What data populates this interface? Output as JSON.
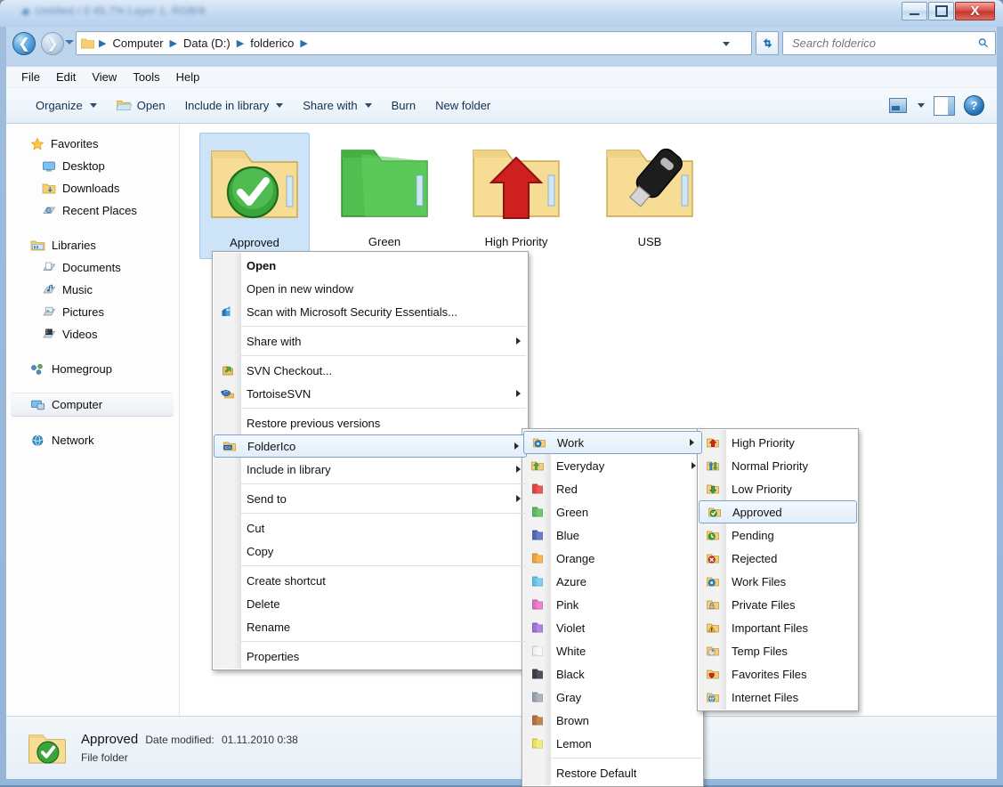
{
  "window": {
    "title_blurred": "Untitled / 0 45.7% Layer 1, RGB/8",
    "buttons": {
      "minimize": "Minimize",
      "maximize": "Maximize",
      "close": "X"
    }
  },
  "address_bar": {
    "back": "Back",
    "forward": "Forward",
    "recent_pages": "Recent Pages",
    "crumbs": [
      "Computer",
      "Data (D:)",
      "folderico"
    ],
    "refresh": "Refresh",
    "dropdown": "Previous Locations"
  },
  "search": {
    "placeholder": "Search folderico",
    "value": "",
    "icon": "search-icon"
  },
  "menubar": {
    "items": [
      "File",
      "Edit",
      "View",
      "Tools",
      "Help"
    ]
  },
  "commandbar": {
    "organize": "Organize",
    "open": "Open",
    "include_in_library": "Include in library",
    "share_with": "Share with",
    "burn": "Burn",
    "new_folder": "New folder",
    "change_view": "Change your view",
    "preview_pane": "Show the preview pane",
    "help": "?"
  },
  "navigation_pane": {
    "groups": [
      {
        "header": "Favorites",
        "icon": "star-icon",
        "items": [
          {
            "label": "Desktop",
            "icon": "desktop-icon"
          },
          {
            "label": "Downloads",
            "icon": "downloads-folder-icon"
          },
          {
            "label": "Recent Places",
            "icon": "recent-places-icon"
          }
        ]
      },
      {
        "header": "Libraries",
        "icon": "libraries-icon",
        "items": [
          {
            "label": "Documents",
            "icon": "documents-library-icon"
          },
          {
            "label": "Music",
            "icon": "music-library-icon"
          },
          {
            "label": "Pictures",
            "icon": "pictures-library-icon"
          },
          {
            "label": "Videos",
            "icon": "videos-library-icon"
          }
        ]
      },
      {
        "header": "Homegroup",
        "icon": "homegroup-icon",
        "items": []
      },
      {
        "header": "Computer",
        "icon": "computer-icon",
        "items": [],
        "selected": true
      },
      {
        "header": "Network",
        "icon": "network-icon",
        "items": []
      }
    ]
  },
  "files": [
    {
      "name": "Approved",
      "icon": "folder-approved-icon",
      "selected": true
    },
    {
      "name": "Green",
      "icon": "folder-green-icon",
      "selected": false
    },
    {
      "name": "High Priority",
      "icon": "folder-high-priority-icon",
      "selected": false
    },
    {
      "name": "USB",
      "icon": "folder-usb-icon",
      "selected": false
    }
  ],
  "details_pane": {
    "name": "Approved",
    "date_modified_label": "Date modified:",
    "date_modified_value": "01.11.2010 0:38",
    "type": "File folder",
    "icon": "folder-approved-icon"
  },
  "context_menu": {
    "items": [
      {
        "label": "Open",
        "bold": true,
        "icon": null,
        "submenu": false
      },
      {
        "label": "Open in new window",
        "icon": null,
        "submenu": false
      },
      {
        "label": "Scan with Microsoft Security Essentials...",
        "icon": "security-essentials-icon",
        "submenu": false
      },
      {
        "separator": true
      },
      {
        "label": "Share with",
        "icon": null,
        "submenu": true
      },
      {
        "separator": true
      },
      {
        "label": "SVN Checkout...",
        "icon": "svn-checkout-icon",
        "submenu": false
      },
      {
        "label": "TortoiseSVN",
        "icon": "tortoisesvn-icon",
        "submenu": true
      },
      {
        "separator": true
      },
      {
        "label": "Restore previous versions",
        "icon": null,
        "submenu": false
      },
      {
        "label": "FolderIco",
        "icon": "folderico-icon",
        "submenu": true,
        "highlighted": true
      },
      {
        "label": "Include in library",
        "icon": null,
        "submenu": true
      },
      {
        "separator": true
      },
      {
        "label": "Send to",
        "icon": null,
        "submenu": true
      },
      {
        "separator": true
      },
      {
        "label": "Cut",
        "icon": null,
        "submenu": false
      },
      {
        "label": "Copy",
        "icon": null,
        "submenu": false
      },
      {
        "separator": true
      },
      {
        "label": "Create shortcut",
        "icon": null,
        "submenu": false
      },
      {
        "label": "Delete",
        "icon": null,
        "submenu": false
      },
      {
        "label": "Rename",
        "icon": null,
        "submenu": false
      },
      {
        "separator": true
      },
      {
        "label": "Properties",
        "icon": null,
        "submenu": false
      }
    ]
  },
  "folderico_submenu": {
    "items": [
      {
        "label": "Work",
        "icon": "folder-work-icon",
        "submenu": true,
        "highlighted": true,
        "color": "#f0c860"
      },
      {
        "label": "Everyday",
        "icon": "folder-everyday-icon",
        "submenu": true,
        "color": "#f0c860"
      },
      {
        "label": "Red",
        "icon": "folder-red-icon",
        "color": "#e2453c"
      },
      {
        "label": "Green",
        "icon": "folder-green-icon",
        "color": "#5cb85c"
      },
      {
        "label": "Blue",
        "icon": "folder-blue-icon",
        "color": "#5566b8"
      },
      {
        "label": "Orange",
        "icon": "folder-orange-icon",
        "color": "#f0a33a"
      },
      {
        "label": "Azure",
        "icon": "folder-azure-icon",
        "color": "#63c1e8"
      },
      {
        "label": "Pink",
        "icon": "folder-pink-icon",
        "color": "#e46fc0"
      },
      {
        "label": "Violet",
        "icon": "folder-violet-icon",
        "color": "#a56ed8"
      },
      {
        "label": "White",
        "icon": "folder-white-icon",
        "color": "#f2f2f2"
      },
      {
        "label": "Black",
        "icon": "folder-black-icon",
        "color": "#3b3f45"
      },
      {
        "label": "Gray",
        "icon": "folder-gray-icon",
        "color": "#9aa3ad"
      },
      {
        "label": "Brown",
        "icon": "folder-brown-icon",
        "color": "#b5703a"
      },
      {
        "label": "Lemon",
        "icon": "folder-lemon-icon",
        "color": "#ece35a"
      },
      {
        "separator": true
      },
      {
        "label": "Restore Default",
        "icon": null
      }
    ]
  },
  "work_submenu": {
    "items": [
      {
        "label": "High Priority",
        "icon": "folder-arrow-up-red-icon"
      },
      {
        "label": "Normal Priority",
        "icon": "folder-arrow-updown-icon"
      },
      {
        "label": "Low Priority",
        "icon": "folder-arrow-down-green-icon"
      },
      {
        "label": "Approved",
        "icon": "folder-check-green-icon",
        "highlighted": true
      },
      {
        "label": "Pending",
        "icon": "folder-clock-green-icon"
      },
      {
        "label": "Rejected",
        "icon": "folder-cross-red-icon"
      },
      {
        "label": "Work Files",
        "icon": "folder-gear-blue-icon"
      },
      {
        "label": "Private Files",
        "icon": "folder-lock-icon"
      },
      {
        "label": "Important Files",
        "icon": "folder-warning-icon"
      },
      {
        "label": "Temp Files",
        "icon": "folder-pie-icon"
      },
      {
        "label": "Favorites Files",
        "icon": "folder-heart-red-icon"
      },
      {
        "label": "Internet Files",
        "icon": "folder-globe-icon"
      }
    ]
  },
  "colors": {
    "selection_blue": "#cde3f7",
    "highlight_border": "#7da2ce",
    "menu_bg": "#ffffff",
    "gutter": "#f1f1f1"
  }
}
